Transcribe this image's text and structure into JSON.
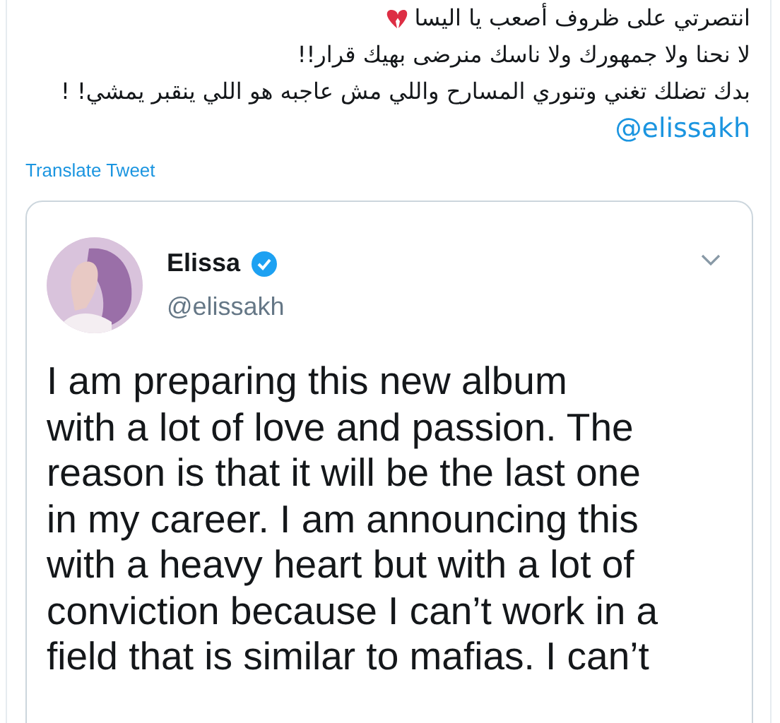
{
  "tweet": {
    "lines": [
      "انتصرتي على ظروف أصعب يا اليسا",
      "لا نحنا ولا جمهورك ولا ناسك منرضى بهيك قرار!!",
      "بدك تضلك تغني وتنوري المسارح  واللي مش عاجبه هو اللي ينقبر يمشي! !"
    ],
    "mention": "@elissakh",
    "translate": "Translate Tweet"
  },
  "quoted": {
    "name": "Elissa",
    "verified": true,
    "handle": "@elissakh",
    "text": "I am preparing this new album\nwith a lot of love and passion. The\nreason is that it will be the last one\nin my career. I am announcing this\nwith a heavy heart but with a lot of\nconviction because I can’t work in a\nfield that is similar to mafias. I can’t"
  }
}
